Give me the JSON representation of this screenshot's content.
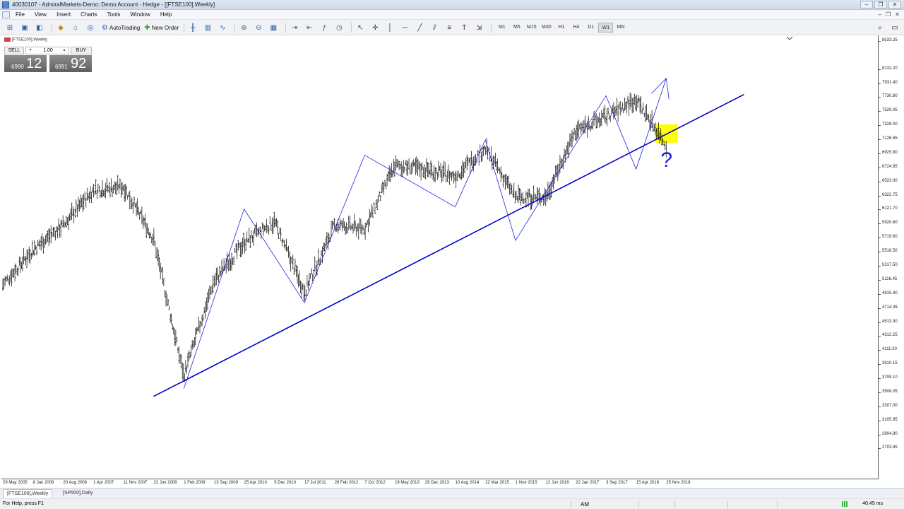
{
  "window": {
    "title": "40030107 - AdmiralMarkets-Demo: Demo Account - Hedge - [[FTSE100],Weekly]",
    "buttons": [
      "‒",
      "❐",
      "✕"
    ]
  },
  "menu": {
    "items": [
      "File",
      "View",
      "Insert",
      "Charts",
      "Tools",
      "Window",
      "Help"
    ],
    "mdi_buttons": [
      "–",
      "❐",
      "✕"
    ]
  },
  "toolbar": {
    "autotrading_label": "AutoTrading",
    "new_order_label": "New Order",
    "timeframes": [
      "M1",
      "M5",
      "M15",
      "M30",
      "H1",
      "H4",
      "D1",
      "W1",
      "MN"
    ],
    "active_timeframe": "W1"
  },
  "chart": {
    "symbol_label": "[FTSE100],Weekly",
    "sell_label": "SELL",
    "buy_label": "BUY",
    "lot_value": "1.00",
    "bid_small": "6990",
    "bid_big": "12",
    "ask_small": "6991",
    "ask_big": "92",
    "annotation_question": "?",
    "highlight_color": "#ffff00",
    "line_color": "#0000cc"
  },
  "chart_data": {
    "type": "bar",
    "title": "",
    "symbol": "FTSE100",
    "timeframe": "Weekly",
    "ylim": [
      2496.39,
      8533.25
    ],
    "y_ticks": [
      "8533.25",
      "8132.20",
      "7931.40",
      "7730.80",
      "7529.05",
      "7328.00",
      "7126.95",
      "6925.90",
      "6724.85",
      "6523.00",
      "6322.75",
      "6121.70",
      "5920.60",
      "5719.60",
      "5518.50",
      "5317.50",
      "5116.45",
      "4915.40",
      "4714.35",
      "4513.30",
      "4312.25",
      "4111.20",
      "3910.15",
      "3709.10",
      "3508.05",
      "3307.00",
      "3105.95",
      "2904.90",
      "2703.85"
    ],
    "x_ticks": [
      "29 May 2005",
      "8 Jan 2006",
      "20 Aug 2006",
      "1 Apr 2007",
      "11 Nov 2007",
      "22 Jun 2008",
      "1 Feb 2009",
      "13 Sep 2009",
      "25 Apr 2010",
      "5 Dec 2010",
      "17 Jul 2011",
      "26 Feb 2012",
      "7 Oct 2012",
      "19 May 2013",
      "29 Dec 2013",
      "10 Aug 2014",
      "22 Mar 2015",
      "1 Nov 2015",
      "12 Jun 2016",
      "22 Jan 2017",
      "3 Sep 2017",
      "15 Apr 2018",
      "25 Nov 2018"
    ],
    "price_path": [
      [
        "29 May 2005",
        5050
      ],
      [
        "8 Jan 2006",
        5550
      ],
      [
        "20 Aug 2006",
        5900
      ],
      [
        "1 Apr 2007",
        6400
      ],
      [
        "11 Nov 2007",
        6450
      ],
      [
        "22 Jun 2008",
        5700
      ],
      [
        "1 Feb 2009",
        3750
      ],
      [
        "13 Sep 2009",
        5100
      ],
      [
        "25 Apr 2010",
        5650
      ],
      [
        "5 Dec 2010",
        5950
      ],
      [
        "17 Jul 2011",
        4950
      ],
      [
        "26 Feb 2012",
        5900
      ],
      [
        "7 Oct 2012",
        5850
      ],
      [
        "19 May 2013",
        6750
      ],
      [
        "29 Dec 2013",
        6700
      ],
      [
        "10 Aug 2014",
        6600
      ],
      [
        "22 Mar 2015",
        7000
      ],
      [
        "1 Nov 2015",
        6300
      ],
      [
        "12 Jun 2016",
        6300
      ],
      [
        "22 Jan 2017",
        7250
      ],
      [
        "3 Sep 2017",
        7450
      ],
      [
        "15 Apr 2018",
        7700
      ],
      [
        "25 Nov 2018",
        7050
      ]
    ],
    "trendline": {
      "from": [
        "22 Jun 2008",
        3450
      ],
      "to": [
        "25 Nov 2018",
        7200
      ]
    },
    "zigzag": [
      [
        "1 Feb 2009",
        3560
      ],
      [
        "25 Apr 2010",
        6130
      ],
      [
        "17 Jul 2011",
        4790
      ],
      [
        "7 Oct 2012",
        6900
      ],
      [
        "10 Aug 2014",
        6160
      ],
      [
        "22 Mar 2015",
        7120
      ],
      [
        "1 Nov 2015",
        5680
      ],
      [
        "3 Sep 2017",
        7750
      ],
      [
        "15 Apr 2018",
        6700
      ],
      [
        "25 Nov 2018",
        8000
      ]
    ],
    "grid": false
  },
  "tabs": [
    "[FTSE100],Weekly",
    "[SP500],Daily"
  ],
  "status": {
    "help": "For Help, press F1",
    "session": "AM",
    "ping": "40.45 ms"
  }
}
